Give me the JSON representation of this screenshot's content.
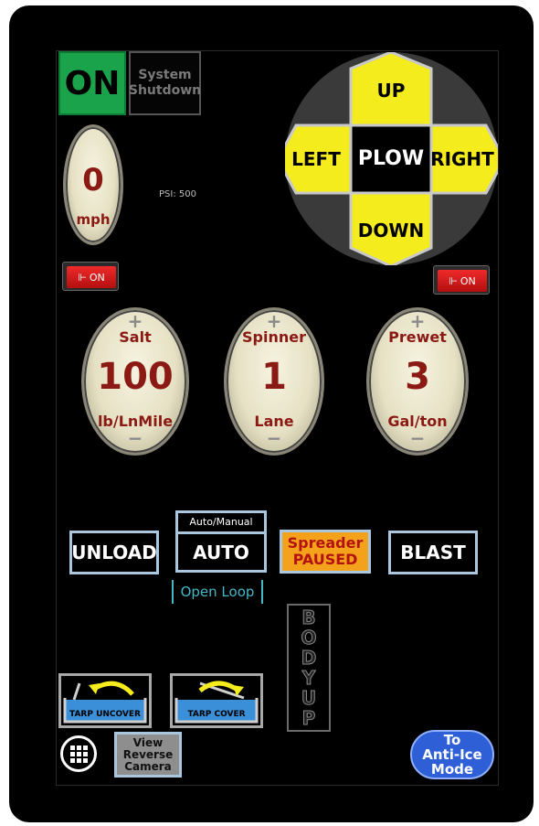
{
  "power": {
    "on_label": "ON",
    "shutdown_line1": "System",
    "shutdown_line2": "Shutdown"
  },
  "plow": {
    "up": "UP",
    "down": "DOWN",
    "left": "LEFT",
    "right": "RIGHT",
    "center": "PLOW"
  },
  "speed": {
    "value": "0",
    "unit": "mph"
  },
  "psi": "PSI: 500",
  "toggles": {
    "left_label": "ON",
    "right_label": "ON"
  },
  "dials": [
    {
      "name": "Salt",
      "value": "100",
      "unit": "lb/LnMile"
    },
    {
      "name": "Spinner",
      "value": "1",
      "unit": "Lane"
    },
    {
      "name": "Prewet",
      "value": "3",
      "unit": "Gal/ton"
    }
  ],
  "buttons": {
    "unload": "UNLOAD",
    "auto_header": "Auto/Manual",
    "auto": "AUTO",
    "open_loop": "Open Loop",
    "paused_line1": "Spreader",
    "paused_line2": "PAUSED",
    "blast": "BLAST"
  },
  "body_up": [
    "B",
    "O",
    "D",
    "Y",
    "U",
    "P"
  ],
  "tarp": {
    "uncover": "TARP UNCOVER",
    "cover": "TARP COVER"
  },
  "camera": {
    "line1": "View",
    "line2": "Reverse",
    "line3": "Camera"
  },
  "anti_ice": {
    "line1": "To",
    "line2": "Anti-Ice",
    "line3": "Mode"
  },
  "colors": {
    "on_green": "#1aa34a",
    "dpad_yellow": "#f5ec1e",
    "dial_red": "#8b1a14",
    "toggle_red": "#e02020",
    "paused_orange": "#f4a21b",
    "anti_blue": "#2f5fd6",
    "outline_blue": "#a9c8e0"
  }
}
